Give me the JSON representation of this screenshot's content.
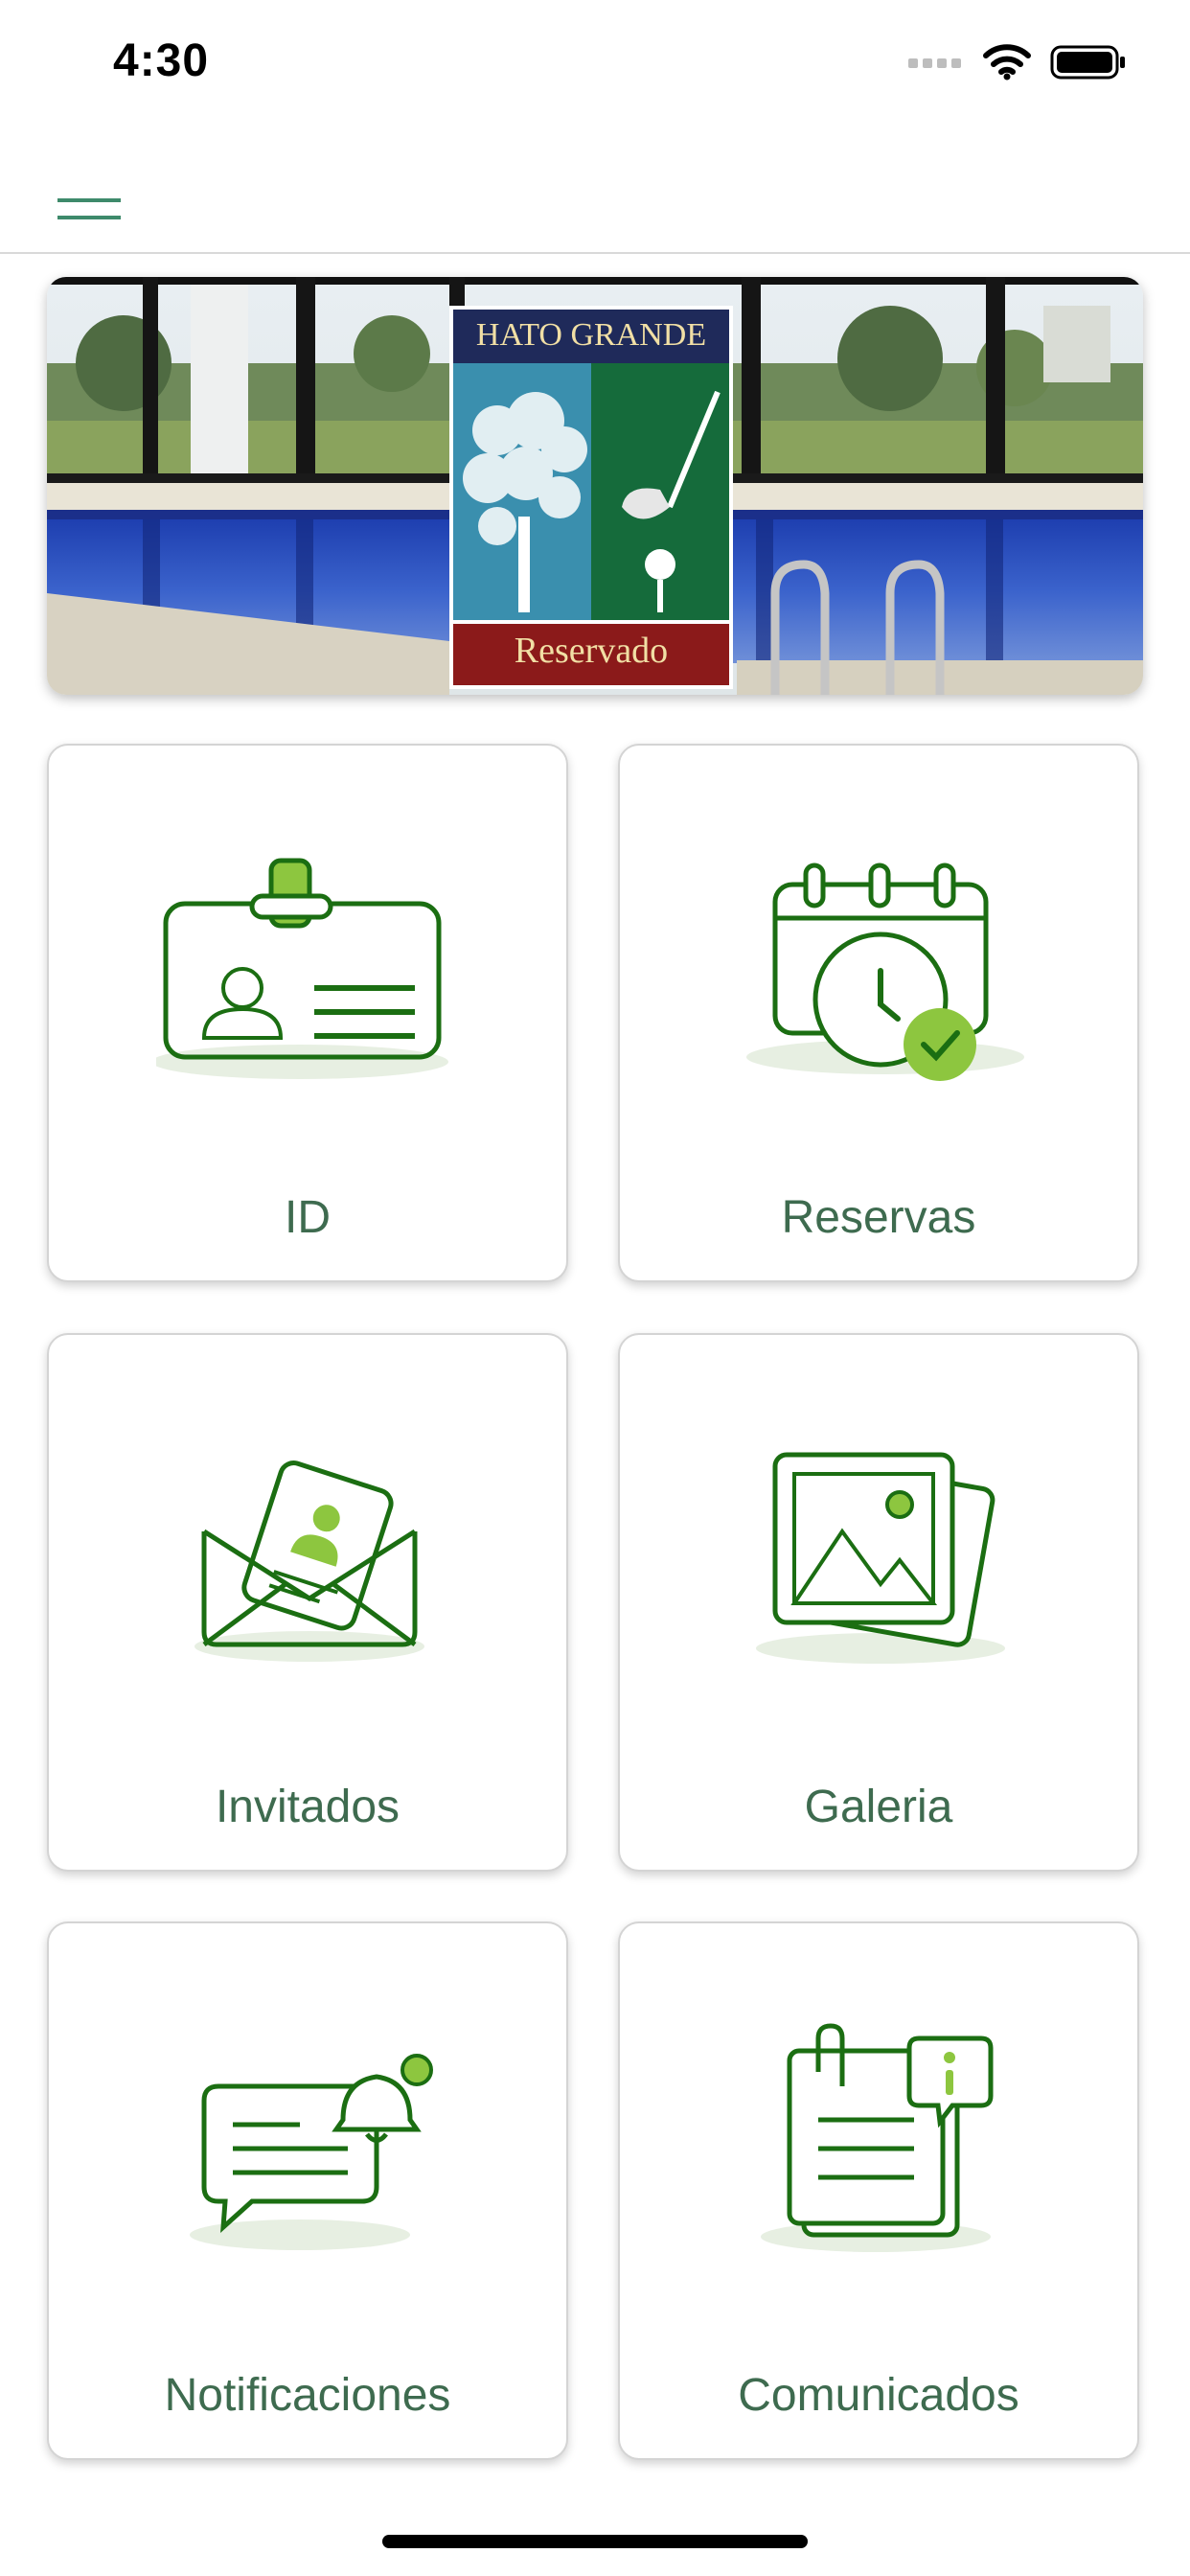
{
  "status_bar": {
    "time": "4:30"
  },
  "banner": {
    "logo_title": "HATO GRANDE",
    "logo_subtitle": "Reservado"
  },
  "tiles": [
    {
      "label": "ID"
    },
    {
      "label": "Reservas"
    },
    {
      "label": "Invitados"
    },
    {
      "label": "Galeria"
    },
    {
      "label": "Notificaciones"
    },
    {
      "label": "Comunicados"
    }
  ],
  "colors": {
    "icon_green": "#1b6e12",
    "accent_lime": "#8dc63f",
    "label_green": "#3e6b4f",
    "logo_red": "#8b1a1a",
    "logo_navy": "#1f2a5a"
  }
}
